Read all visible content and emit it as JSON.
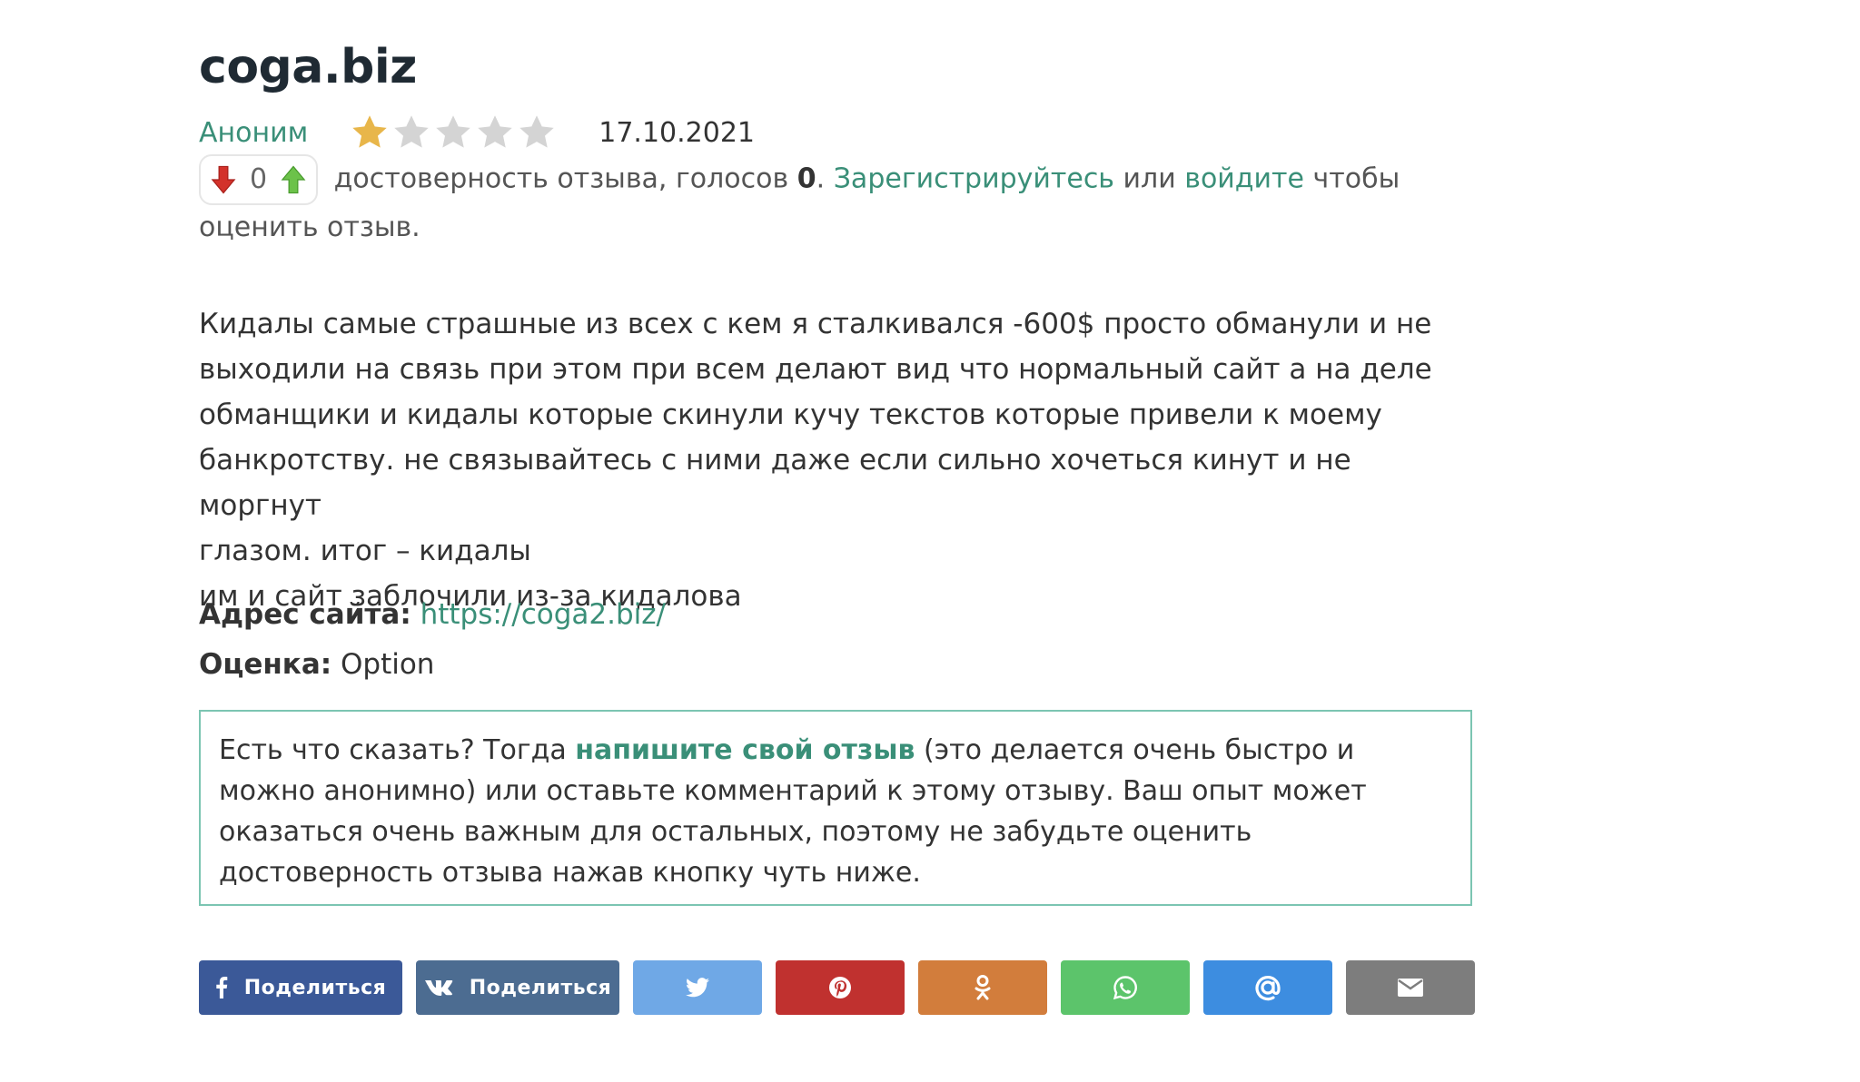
{
  "title": "coga.biz",
  "review_meta": {
    "author": "Аноним",
    "rating": 1,
    "rating_max": 5,
    "date": "17.10.2021"
  },
  "vote": {
    "count": "0",
    "text_before": "достоверность отзыва, голосов",
    "votes_value": "0",
    "period": ".",
    "register_link": "Зарегистрируйтесь",
    "or_text": "или",
    "login_link": "войдите",
    "text_after": "чтобы оценить отзыв."
  },
  "review": {
    "lines": [
      "Кидалы самые страшные из всех с кем я сталкивался -600$ просто обманули и не",
      "выходили на связь при этом при всем делают вид что нормальный сайт а на деле",
      "обманщики и кидалы которые скинули кучу текстов которые привели к моему",
      "банкротству. не связывайтесь с ними даже если сильно хочеться кинут и не моргнут",
      "глазом. итог – кидалы",
      "им и сайт заблочили из-за кидалова"
    ]
  },
  "fields": {
    "site_label": "Адрес сайта:",
    "site_url": "https://coga2.biz/",
    "score_label": "Оценка:",
    "score_value": "Option"
  },
  "note": {
    "text_before": "Есть что сказать? Тогда",
    "link": "напишите свой отзыв",
    "text_after": "(это делается очень быстро и можно анонимно) или оставьте комментарий к этому отзыву. Ваш опыт может оказаться очень важным для остальных, поэтому не забудьте оценить достоверность отзыва нажав кнопку чуть ниже."
  },
  "share": {
    "buttons": [
      {
        "name": "facebook",
        "label": "Поделиться",
        "color": "#3b5998",
        "icon": "facebook-icon"
      },
      {
        "name": "vk",
        "label": "Поделиться",
        "color": "#4c6c91",
        "icon": "vk-icon"
      },
      {
        "name": "twitter",
        "label": "",
        "color": "#6fa8e6",
        "icon": "twitter-icon"
      },
      {
        "name": "pinterest",
        "label": "",
        "color": "#c0312f",
        "icon": "pinterest-icon"
      },
      {
        "name": "odnoklassniki",
        "label": "",
        "color": "#d27d3c",
        "icon": "odnoklassniki-icon"
      },
      {
        "name": "whatsapp",
        "label": "",
        "color": "#5cc46b",
        "icon": "whatsapp-icon"
      },
      {
        "name": "mailru",
        "label": "",
        "color": "#3d8de0",
        "icon": "mailru-icon"
      },
      {
        "name": "email",
        "label": "",
        "color": "#7d7d7d",
        "icon": "email-icon"
      }
    ]
  },
  "colors": {
    "link": "#3a8f78",
    "star_filled": "#e8b64a",
    "star_empty": "#d4d4d4",
    "note_border": "#7cc5b2"
  }
}
